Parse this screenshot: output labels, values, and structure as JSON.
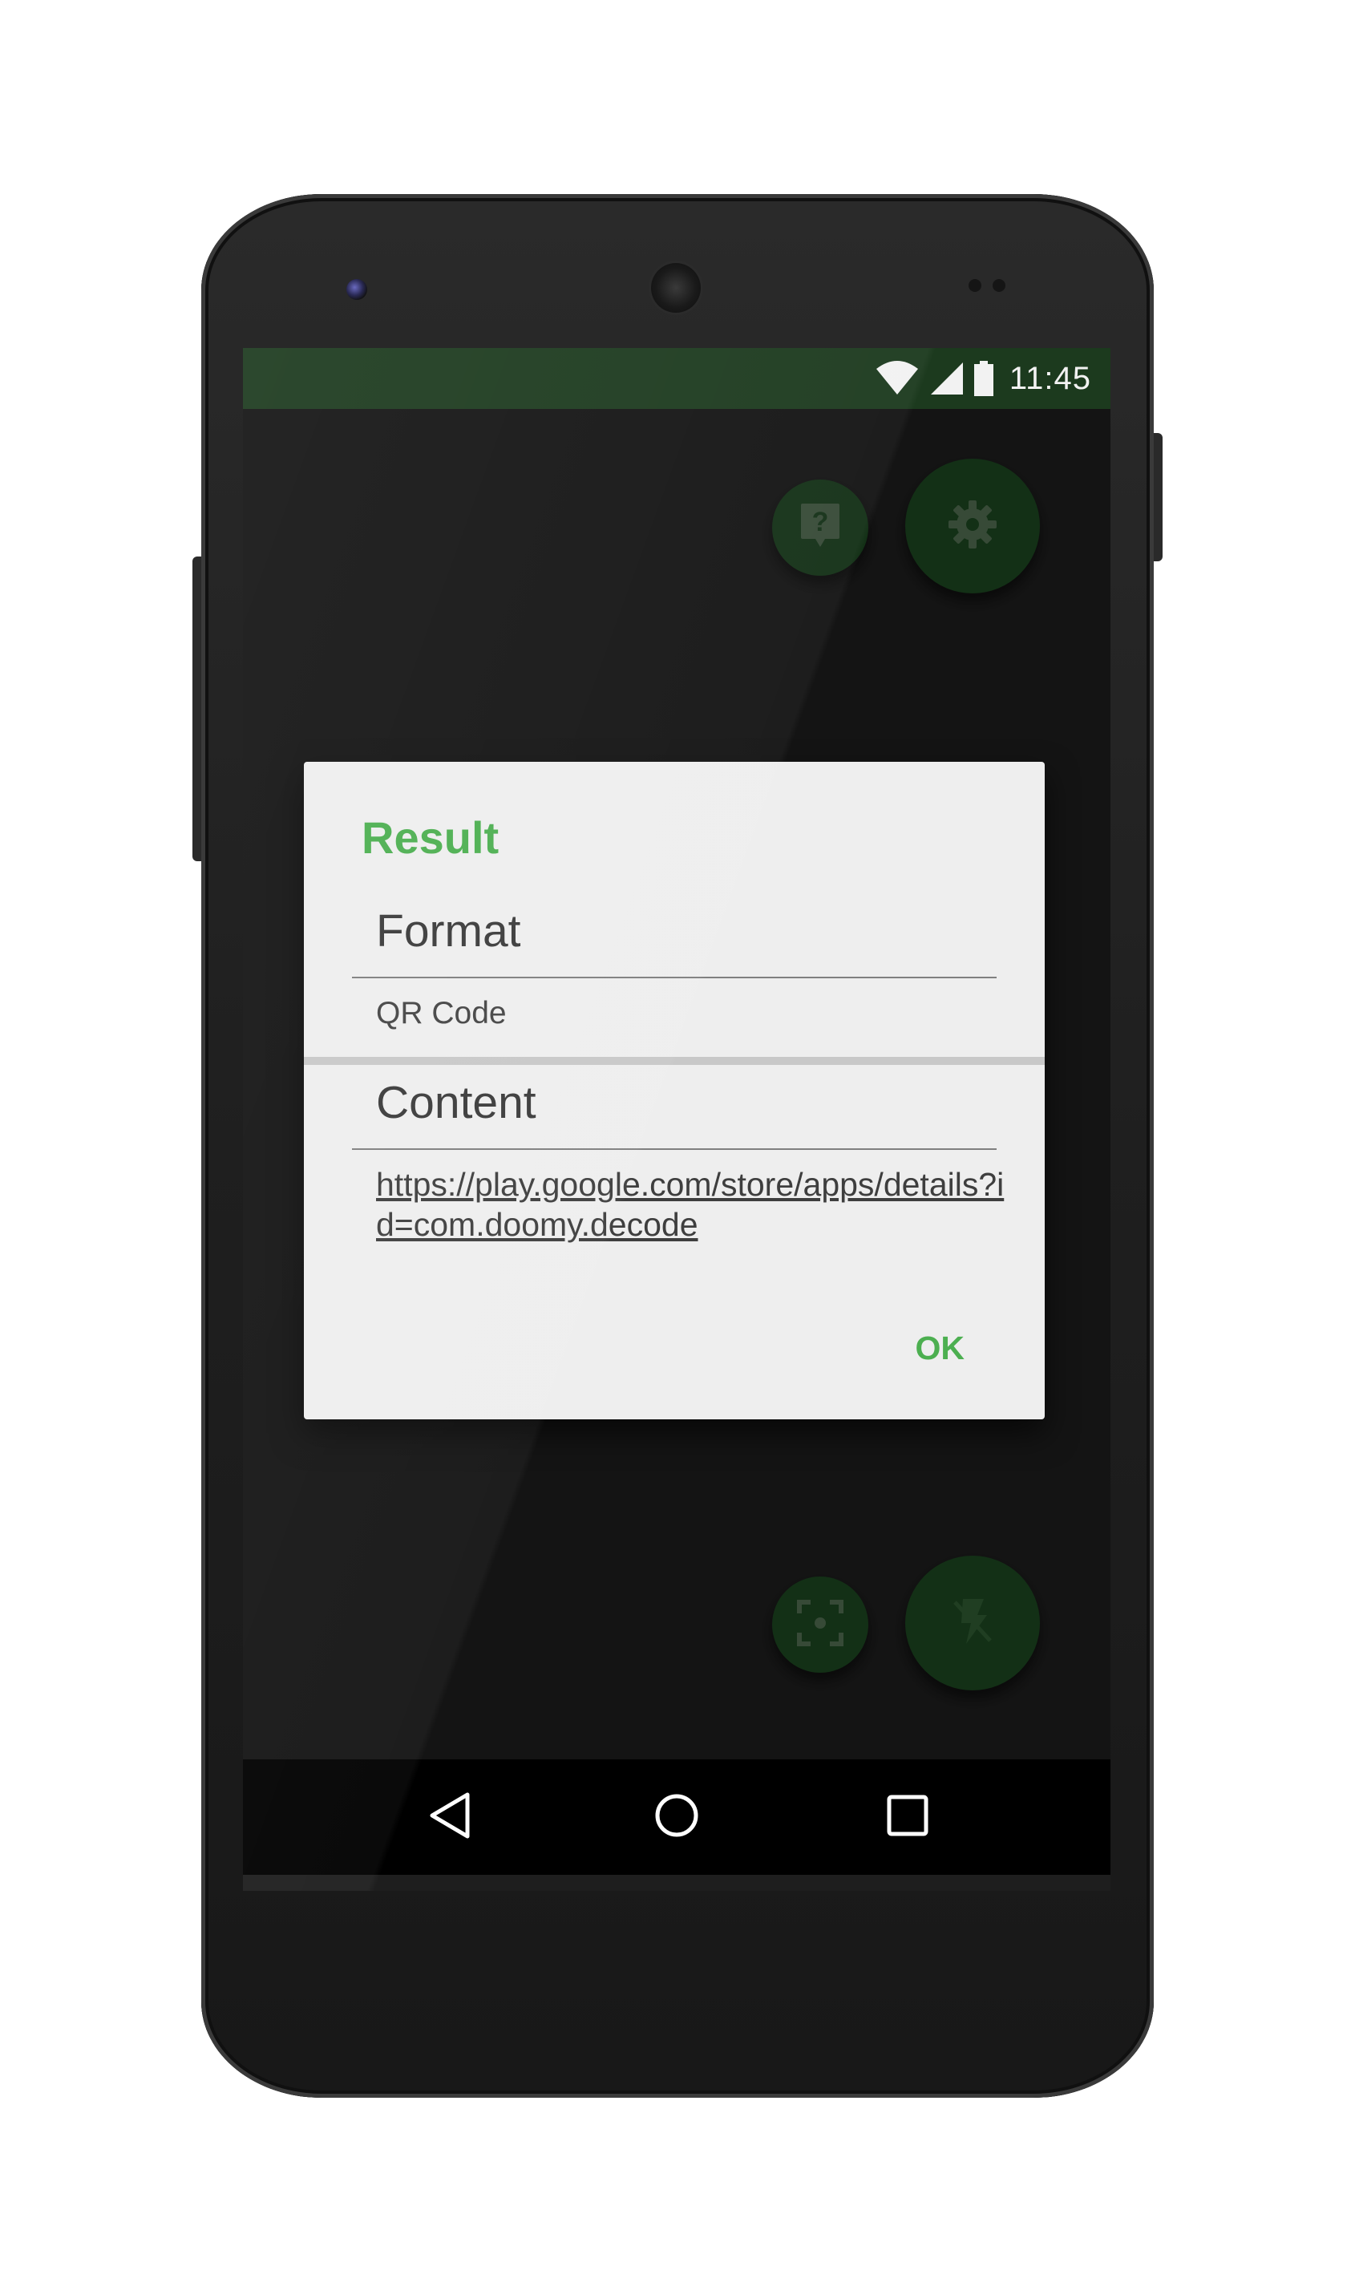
{
  "status_bar": {
    "time": "11:45",
    "icons": [
      "wifi-icon",
      "cell-signal-icon",
      "battery-icon"
    ]
  },
  "top_actions": {
    "help_icon": "help-icon",
    "settings_icon": "settings-gear-icon"
  },
  "bottom_actions": {
    "focus_icon": "focus-frame-icon",
    "flash_icon": "flash-off-icon"
  },
  "dialog": {
    "title": "Result",
    "format_label": "Format",
    "format_value": "QR Code",
    "content_label": "Content",
    "content_value": "https://play.google.com/store/apps/details?id=com.doomy.decode",
    "ok_label": "OK"
  },
  "nav_bar": {
    "back_icon": "back-triangle-icon",
    "home_icon": "home-circle-icon",
    "recents_icon": "recents-square-icon"
  },
  "colors": {
    "accent": "#4caf50",
    "primary_dark": "#1c3a1e",
    "fab": "#1c4520",
    "dialog_background": "#eeeeee"
  }
}
